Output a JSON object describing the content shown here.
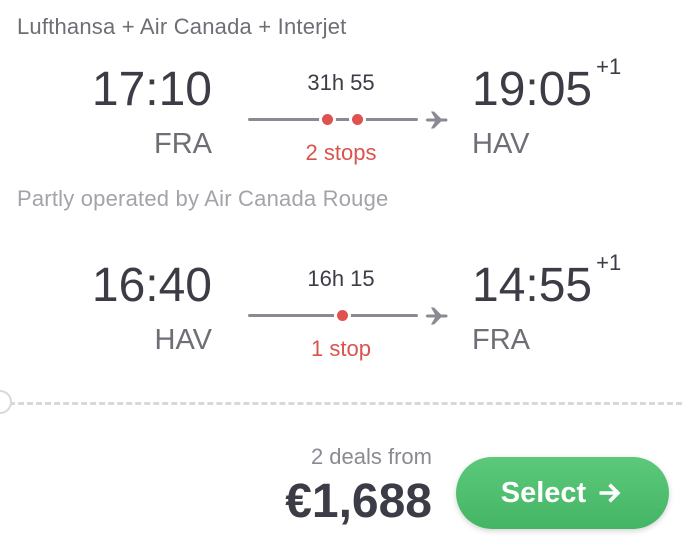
{
  "airlines": "Lufthansa + Air Canada + Interjet",
  "operated_note": "Partly operated by Air Canada Rouge",
  "outbound": {
    "departure_time": "17:10",
    "departure_airport": "FRA",
    "arrival_time": "19:05",
    "arrival_day_offset": "+1",
    "arrival_airport": "HAV",
    "duration": "31h 55",
    "stops_label": "2 stops",
    "stop_count": 2
  },
  "inbound": {
    "departure_time": "16:40",
    "departure_airport": "HAV",
    "arrival_time": "14:55",
    "arrival_day_offset": "+1",
    "arrival_airport": "FRA",
    "duration": "16h 15",
    "stops_label": "1 stop",
    "stop_count": 1
  },
  "pricing": {
    "deals_label": "2 deals from",
    "price": "€1,688"
  },
  "select_button": {
    "label": "Select",
    "icon": "arrow-right-icon"
  },
  "colors": {
    "stops": "#d9534f",
    "select_button": "#4cbd6d",
    "text_primary": "#3c3c46",
    "text_secondary": "#6e6e76"
  }
}
